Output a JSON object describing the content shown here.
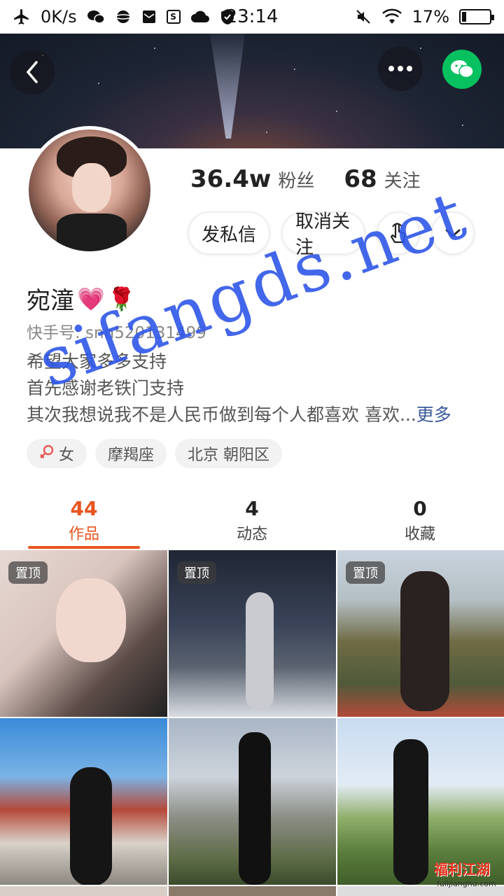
{
  "status_bar": {
    "net_speed": "0K/s",
    "time": "23:14",
    "battery": "17%",
    "battery_level": 0.17
  },
  "header": {
    "back_icon": "chevron-left-icon",
    "more_icon": "ellipsis-icon",
    "share_icon": "wechat-icon"
  },
  "profile": {
    "name": "宛潼",
    "name_emoji_heart": "💗",
    "name_emoji_rose": "🌹",
    "kuaishou_id": "快手号: snn520131499",
    "followers_count": "36.4w",
    "followers_label": "粉丝",
    "following_count": "68",
    "following_label": "关注",
    "bio_lines": [
      "希望大家多多支持",
      "首先感谢老铁门支持",
      "其次我想说我不是人民币做到每个人都喜欢 喜欢..."
    ],
    "bio_more": "更多"
  },
  "actions": {
    "message_label": "发私信",
    "unfollow_label": "取消关注",
    "poke_icon": "hand-pointer-icon",
    "expand_icon": "chevron-down-icon"
  },
  "tags": {
    "gender_icon": "female-icon",
    "gender": "女",
    "zodiac": "摩羯座",
    "location": "北京 朝阳区"
  },
  "tabs": [
    {
      "count": "44",
      "label": "作品",
      "active": true
    },
    {
      "count": "4",
      "label": "动态",
      "active": false
    },
    {
      "count": "0",
      "label": "收藏",
      "active": false
    }
  ],
  "grid": {
    "pin_label": "置顶"
  },
  "watermarks": {
    "main": "sifangds.net",
    "corner": "福利江湖",
    "corner_url": "fulijianghu.com"
  },
  "colors": {
    "accent": "#e8551f",
    "watermark": "#2f57e8",
    "wechat": "#07c160"
  }
}
